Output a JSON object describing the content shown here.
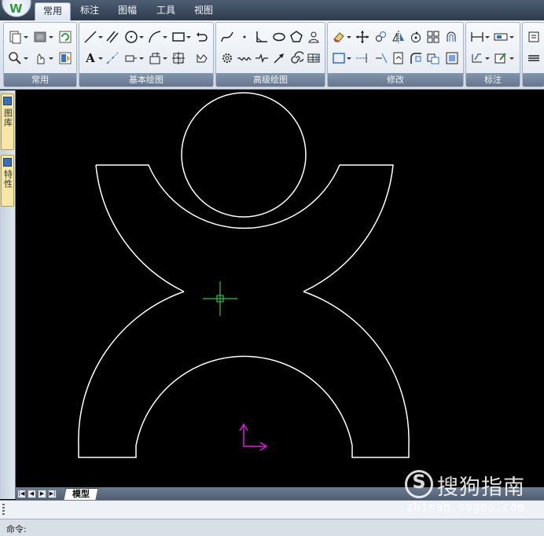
{
  "ribbon_tabs": [
    {
      "label": "常用",
      "active": true
    },
    {
      "label": "标注",
      "active": false
    },
    {
      "label": "图幅",
      "active": false
    },
    {
      "label": "工具",
      "active": false
    },
    {
      "label": "视图",
      "active": false
    }
  ],
  "ribbon_groups": [
    {
      "label": "常用"
    },
    {
      "label": "基本绘图"
    },
    {
      "label": "高级绘图"
    },
    {
      "label": "修改"
    },
    {
      "label": "标注"
    }
  ],
  "ribbon_icons": {
    "row1": [
      "new-file-icon",
      "layer-icon",
      "refresh-icon",
      "line-icon",
      "parallel-line-icon",
      "circle-icon",
      "arc-icon",
      "rectangle-icon",
      "undo-curve-icon",
      "spline-icon",
      "point-icon",
      "angle-icon",
      "ellipse-icon",
      "polygon-icon",
      "hatch-user-icon",
      "eraser-icon",
      "move-icon",
      "copy-icon",
      "mirror-icon",
      "rotate-icon",
      "array-icon",
      "offset-icon",
      "dimension-icon",
      "dimension-style-icon",
      "right-panel-icon"
    ],
    "row2": [
      "zoom-icon",
      "pan-icon",
      "paint-icon",
      "text-icon",
      "centerline-icon",
      "block-icon",
      "insert-block-icon",
      "hatch-icon",
      "region-icon",
      "gear-icon",
      "wave-icon",
      "break-line-icon",
      "arrow-icon",
      "spiral-icon",
      "table-icon",
      "select-box-icon",
      "extend-icon",
      "trim-icon",
      "stretch-icon",
      "fillet-icon",
      "explode-icon",
      "scale-icon",
      "tolerance-icon",
      "edit-icon",
      "lines-icon"
    ]
  },
  "left_panels": [
    {
      "label": "图库",
      "icon": "library-icon"
    },
    {
      "label": "特性",
      "icon": "properties-icon"
    }
  ],
  "layout_tabs": {
    "active": "模型"
  },
  "command": {
    "prompt": "命令:"
  },
  "watermark": {
    "name": "搜狗指南",
    "url": "zhinan.sogou.com",
    "logo_letter": "S"
  },
  "colors": {
    "canvas": "#000000",
    "drawing": "#ffffff",
    "ucs": "#d81ed8",
    "crosshair": "#2dbf4a",
    "panel_tab": "#f6e7a6"
  }
}
